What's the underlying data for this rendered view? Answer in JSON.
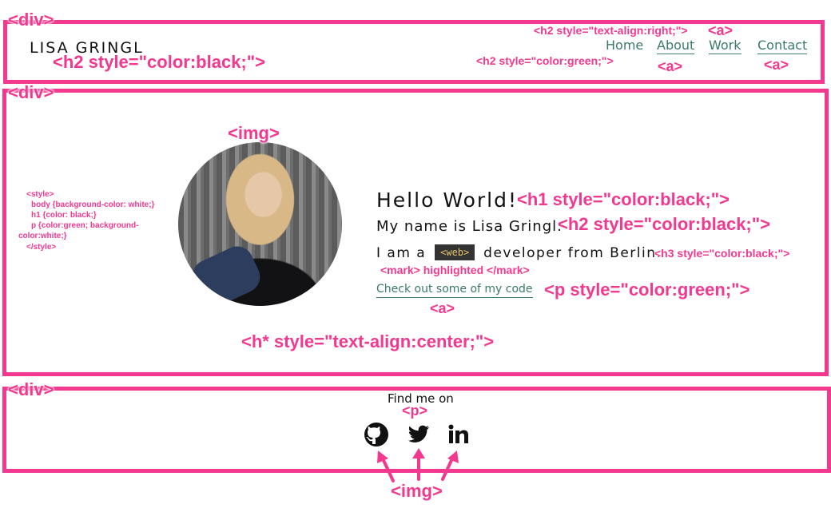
{
  "annotations": {
    "div_header": "<div>",
    "div_main": "<div>",
    "div_footer": "<div>",
    "h2_right": "<h2 style=\"text-align:right;\">",
    "a_top": "<a>",
    "h2_black_header": "<h2 style=\"color:black;\">",
    "h2_green": "<h2 style=\"color:green;\">",
    "a_about": "<a>",
    "a_contact": "<a>",
    "img_avatar": "<img>",
    "h1_black": "<h1 style=\"color:black;\">",
    "h2_black_main": "<h2 style=\"color:black;\">",
    "h3_black": "<h3 style=\"color:black;\">",
    "mark_highlighted": "<mark> highlighted </mark>",
    "p_green": "<p style=\"color:green;\">",
    "a_code": "<a>",
    "h_center": "<h* style=\"text-align:center;\">",
    "p_footer": "<p>",
    "img_footer": "<img>",
    "style_open": "<style>",
    "style_body": "body {background-color: white;}",
    "style_h1": "h1 {color: black;}",
    "style_p1": "p {color:green; background-",
    "style_p2": "color:white;}",
    "style_close": "</style>"
  },
  "header": {
    "logo": "LISA GRINGL",
    "nav": [
      "Home",
      "About",
      "Work",
      "Contact"
    ]
  },
  "main": {
    "hello": "Hello World!",
    "name_line": "My name is Lisa Gringl.",
    "iam_prefix": "I am a",
    "mark_text": "<web>",
    "iam_suffix": "developer from Berlin.",
    "code_link": "Check out some of my code"
  },
  "footer": {
    "find_me": "Find me on",
    "icons": [
      "github-icon",
      "twitter-icon",
      "linkedin-icon"
    ]
  },
  "colors": {
    "annotation": "#f2398f",
    "link_green": "#3a7a6a",
    "mark_bg": "#333333",
    "mark_text": "#e3c46b"
  }
}
